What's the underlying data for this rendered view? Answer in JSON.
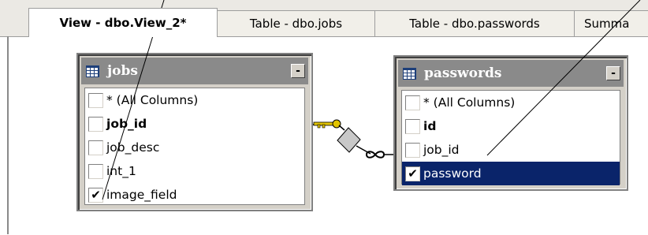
{
  "tabs": [
    {
      "label": "View - dbo.View_2*",
      "active": true
    },
    {
      "label": "Table - dbo.jobs",
      "active": false
    },
    {
      "label": "Table - dbo.passwords",
      "active": false
    },
    {
      "label": "Summa",
      "active": false
    }
  ],
  "jobs_table": {
    "title": "jobs",
    "minimize_label": "-",
    "rows": [
      {
        "label": "* (All Columns)",
        "checked": false,
        "bold": false
      },
      {
        "label": "job_id",
        "checked": false,
        "bold": true
      },
      {
        "label": "job_desc",
        "checked": false,
        "bold": false
      },
      {
        "label": "int_1",
        "checked": false,
        "bold": false
      },
      {
        "label": "image_field",
        "checked": true,
        "bold": false
      }
    ]
  },
  "passwords_table": {
    "title": "passwords",
    "minimize_label": "-",
    "rows": [
      {
        "label": "* (All Columns)",
        "checked": false,
        "bold": false
      },
      {
        "label": "id",
        "checked": false,
        "bold": true
      },
      {
        "label": "job_id",
        "checked": false,
        "bold": false
      },
      {
        "label": "password",
        "checked": true,
        "bold": false,
        "selected": true
      }
    ]
  },
  "colors": {
    "selection": "#0a246a",
    "title_bar": "#8a8a8a",
    "panel_face": "#d4d0c8",
    "key_icon": "#e2c400"
  },
  "icons": {
    "table_icon": "grid-icon",
    "relationship_key": "key-icon",
    "relationship_many": "infinity-icon",
    "check": "✔"
  }
}
